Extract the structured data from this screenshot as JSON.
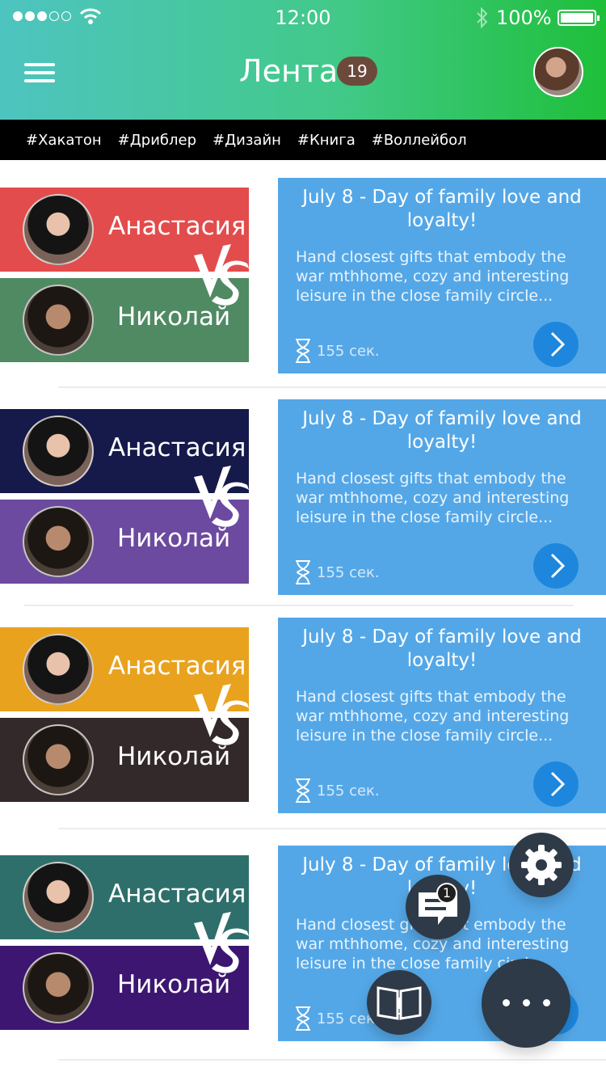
{
  "status_bar": {
    "time": "12:00",
    "battery": "100%",
    "signal_filled": 3,
    "signal_total": 5
  },
  "header": {
    "title": "Лента",
    "badge_count": "19"
  },
  "tags": [
    "#Хакатон",
    "#Дриблер",
    "#Дизайн",
    "#Книга",
    "#Воллейбол"
  ],
  "feed": [
    {
      "player_a": {
        "name": "Анастасия",
        "color": "#e34c4c"
      },
      "player_b": {
        "name": "Николай",
        "color": "#4f8a63"
      },
      "card": {
        "title": "July 8 - Day of family love and loyalty!",
        "text": "Hand closest gifts that embody the war mthhome, cozy and interesting leisure in the close family circle...",
        "timer": "155 сек."
      }
    },
    {
      "player_a": {
        "name": "Анастасия",
        "color": "#161a4a"
      },
      "player_b": {
        "name": "Николай",
        "color": "#6c4aa0"
      },
      "card": {
        "title": "July 8 - Day of family love and loyalty!",
        "text": "Hand closest gifts that embody the war mthhome, cozy and interesting leisure in the close family circle...",
        "timer": "155 сек."
      }
    },
    {
      "player_a": {
        "name": "Анастасия",
        "color": "#e9a21e"
      },
      "player_b": {
        "name": "Николай",
        "color": "#33292a"
      },
      "card": {
        "title": "July 8 - Day of family love and loyalty!",
        "text": "Hand closest gifts that embody the war mthhome, cozy and interesting leisure in the close family circle...",
        "timer": "155 сек."
      }
    },
    {
      "player_a": {
        "name": "Анастасия",
        "color": "#2e6f6b"
      },
      "player_b": {
        "name": "Николай",
        "color": "#3c1670"
      },
      "card": {
        "title": "July 8 - Day of family love and loyalty!",
        "text": "Hand closest gifts that embody the war mthhome, cozy and interesting leisure in the close family circle...",
        "timer": "155 сек."
      }
    }
  ],
  "fab": {
    "chat_badge": "1"
  },
  "colors": {
    "card": "#54a7e7",
    "go_button": "#1e87dd",
    "fab": "#2e3a47"
  }
}
